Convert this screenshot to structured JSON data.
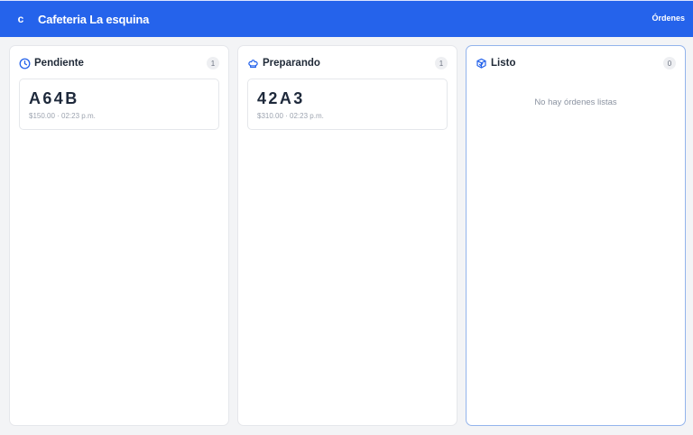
{
  "app": {
    "logo_letter": "c",
    "name": "Cafeteria La esquina",
    "nav_link": "Órdenes",
    "accent": "#2563eb"
  },
  "columns": [
    {
      "title": "Pendiente",
      "icon": "clock-icon",
      "count": "1",
      "orders": [
        {
          "code": "A64B",
          "meta": "$150.00 · 02:23 p.m."
        }
      ]
    },
    {
      "title": "Preparando",
      "icon": "chef-hat-icon",
      "count": "1",
      "orders": [
        {
          "code": "42A3",
          "meta": "$310.00 · 02:23 p.m."
        }
      ]
    },
    {
      "title": "Listo",
      "icon": "package-check-icon",
      "count": "0",
      "empty_text": "No hay órdenes listas"
    }
  ]
}
